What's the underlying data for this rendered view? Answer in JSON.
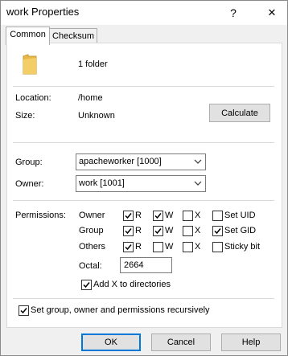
{
  "window": {
    "title": "work Properties",
    "help_glyph": "?",
    "close_glyph": "✕"
  },
  "tabs": [
    {
      "label": "Common"
    },
    {
      "label": "Checksum"
    }
  ],
  "summary": {
    "text": "1 folder",
    "icon": "folder-icon"
  },
  "location": {
    "label": "Location:",
    "value": "/home"
  },
  "size": {
    "label": "Size:",
    "value": "Unknown",
    "calculate_label": "Calculate"
  },
  "group": {
    "label": "Group:",
    "value": "apacheworker [1000]"
  },
  "owner": {
    "label": "Owner:",
    "value": "work [1001]"
  },
  "permissions": {
    "label": "Permissions:",
    "rows": [
      {
        "label": "Owner",
        "r": true,
        "w": true,
        "x": false,
        "extra_label": "Set UID",
        "extra": false
      },
      {
        "label": "Group",
        "r": true,
        "w": true,
        "x": false,
        "extra_label": "Set GID",
        "extra": true
      },
      {
        "label": "Others",
        "r": true,
        "w": false,
        "x": false,
        "extra_label": "Sticky bit",
        "extra": false
      }
    ],
    "r_label": "R",
    "w_label": "W",
    "x_label": "X",
    "octal_label": "Octal:",
    "octal_value": "2664",
    "add_x_label": "Add X to directories",
    "add_x": true
  },
  "recursive": {
    "label": "Set group, owner and permissions recursively",
    "checked": true
  },
  "footer": {
    "ok_label": "OK",
    "cancel_label": "Cancel",
    "help_label": "Help"
  },
  "colors": {
    "folder": "#e8b84a",
    "focus_border": "#0078d7"
  }
}
